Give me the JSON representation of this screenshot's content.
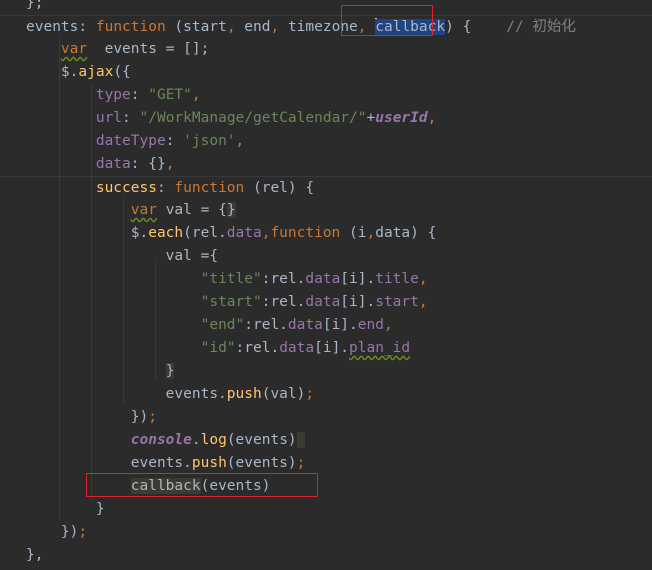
{
  "lines": [
    {
      "tokens": [
        {
          "t": "};",
          "c": "plain"
        }
      ]
    },
    {
      "tokens": [
        {
          "t": "events",
          "c": "plain"
        },
        {
          "t": ": ",
          "c": "plain"
        },
        {
          "t": "function",
          "c": "kw"
        },
        {
          "t": " (start",
          "c": "plain"
        },
        {
          "t": ", ",
          "c": "kw"
        },
        {
          "t": "end",
          "c": "plain"
        },
        {
          "t": ", ",
          "c": "kw"
        },
        {
          "t": "timezone",
          "c": "plain"
        },
        {
          "t": ", ",
          "c": "kw"
        },
        {
          "t": "callback",
          "c": "plain sel",
          "caret": true
        },
        {
          "t": ") {",
          "c": "plain"
        },
        {
          "t": "    // 初始化",
          "c": "cm"
        }
      ]
    },
    {
      "tokens": [
        {
          "t": "    ",
          "c": "plain"
        },
        {
          "t": "var",
          "c": "kw ul"
        },
        {
          "t": "  events = [];",
          "c": "plain"
        }
      ]
    },
    {
      "tokens": [
        {
          "t": "    $.",
          "c": "plain"
        },
        {
          "t": "ajax",
          "c": "fn"
        },
        {
          "t": "({",
          "c": "plain"
        }
      ]
    },
    {
      "tokens": [
        {
          "t": "        ",
          "c": "plain"
        },
        {
          "t": "type",
          "c": "prop"
        },
        {
          "t": ": ",
          "c": "plain"
        },
        {
          "t": "\"GET\"",
          "c": "str"
        },
        {
          "t": ",",
          "c": "kw"
        }
      ]
    },
    {
      "tokens": [
        {
          "t": "        ",
          "c": "plain"
        },
        {
          "t": "url",
          "c": "prop"
        },
        {
          "t": ": ",
          "c": "plain"
        },
        {
          "t": "\"/WorkManage/getCalendar/\"",
          "c": "str"
        },
        {
          "t": "+",
          "c": "plain"
        },
        {
          "t": "userId",
          "c": "gl"
        },
        {
          "t": ",",
          "c": "kw"
        }
      ]
    },
    {
      "tokens": [
        {
          "t": "        ",
          "c": "plain"
        },
        {
          "t": "dateType",
          "c": "prop"
        },
        {
          "t": ": ",
          "c": "plain"
        },
        {
          "t": "'json'",
          "c": "str"
        },
        {
          "t": ",",
          "c": "kw"
        }
      ]
    },
    {
      "tokens": [
        {
          "t": "        ",
          "c": "plain"
        },
        {
          "t": "data",
          "c": "prop"
        },
        {
          "t": ": {}",
          "c": "plain"
        },
        {
          "t": ",",
          "c": "kw"
        }
      ]
    },
    {
      "tokens": [
        {
          "t": "        ",
          "c": "plain"
        },
        {
          "t": "success",
          "c": "fn"
        },
        {
          "t": ": ",
          "c": "plain"
        },
        {
          "t": "function",
          "c": "kw"
        },
        {
          "t": " (rel) {",
          "c": "plain"
        }
      ]
    },
    {
      "tokens": [
        {
          "t": "            ",
          "c": "plain"
        },
        {
          "t": "var",
          "c": "kw ul"
        },
        {
          "t": " val = {",
          "c": "plain"
        },
        {
          "t": "}",
          "c": "plain hl"
        }
      ]
    },
    {
      "tokens": [
        {
          "t": "            $.",
          "c": "plain"
        },
        {
          "t": "each",
          "c": "fn"
        },
        {
          "t": "(rel.",
          "c": "plain"
        },
        {
          "t": "data",
          "c": "prop"
        },
        {
          "t": ",",
          "c": "kw"
        },
        {
          "t": "function",
          "c": "kw"
        },
        {
          "t": " (i",
          "c": "plain"
        },
        {
          "t": ",",
          "c": "kw"
        },
        {
          "t": "data",
          "c": "plain"
        },
        {
          "t": ") {",
          "c": "plain"
        }
      ]
    },
    {
      "tokens": [
        {
          "t": "                val ={",
          "c": "plain"
        }
      ]
    },
    {
      "tokens": [
        {
          "t": "                    ",
          "c": "plain"
        },
        {
          "t": "\"title\"",
          "c": "str"
        },
        {
          "t": ":rel.",
          "c": "plain"
        },
        {
          "t": "data",
          "c": "prop"
        },
        {
          "t": "[i].",
          "c": "plain"
        },
        {
          "t": "title",
          "c": "prop"
        },
        {
          "t": ",",
          "c": "kw"
        }
      ]
    },
    {
      "tokens": [
        {
          "t": "                    ",
          "c": "plain"
        },
        {
          "t": "\"start\"",
          "c": "str"
        },
        {
          "t": ":rel.",
          "c": "plain"
        },
        {
          "t": "data",
          "c": "prop"
        },
        {
          "t": "[i].",
          "c": "plain"
        },
        {
          "t": "start",
          "c": "prop"
        },
        {
          "t": ",",
          "c": "kw"
        }
      ]
    },
    {
      "tokens": [
        {
          "t": "                    ",
          "c": "plain"
        },
        {
          "t": "\"end\"",
          "c": "str"
        },
        {
          "t": ":rel.",
          "c": "plain"
        },
        {
          "t": "data",
          "c": "prop"
        },
        {
          "t": "[i].",
          "c": "plain"
        },
        {
          "t": "end",
          "c": "prop"
        },
        {
          "t": ",",
          "c": "kw"
        }
      ]
    },
    {
      "tokens": [
        {
          "t": "                    ",
          "c": "plain"
        },
        {
          "t": "\"id\"",
          "c": "str"
        },
        {
          "t": ":rel.",
          "c": "plain"
        },
        {
          "t": "data",
          "c": "prop"
        },
        {
          "t": "[i].",
          "c": "plain"
        },
        {
          "t": "plan_id",
          "c": "prop ul"
        }
      ]
    },
    {
      "tokens": [
        {
          "t": "                ",
          "c": "plain"
        },
        {
          "t": "}",
          "c": "plain hl"
        }
      ]
    },
    {
      "tokens": [
        {
          "t": "                events.",
          "c": "plain"
        },
        {
          "t": "push",
          "c": "fn"
        },
        {
          "t": "(val)",
          "c": "plain"
        },
        {
          "t": ";",
          "c": "kw"
        }
      ]
    },
    {
      "tokens": [
        {
          "t": "            })",
          "c": "plain"
        },
        {
          "t": ";",
          "c": "kw"
        }
      ]
    },
    {
      "tokens": [
        {
          "t": "            ",
          "c": "plain"
        },
        {
          "t": "console",
          "c": "gl"
        },
        {
          "t": ".",
          "c": "plain"
        },
        {
          "t": "log",
          "c": "fn"
        },
        {
          "t": "(events)",
          "c": "plain"
        },
        {
          "t": " ",
          "c": "plain hl"
        }
      ]
    },
    {
      "tokens": [
        {
          "t": "            events.",
          "c": "plain"
        },
        {
          "t": "push",
          "c": "fn"
        },
        {
          "t": "(events)",
          "c": "plain"
        },
        {
          "t": ";",
          "c": "kw"
        }
      ]
    },
    {
      "tokens": [
        {
          "t": "            ",
          "c": "plain"
        },
        {
          "t": "callback",
          "c": "plain hl"
        },
        {
          "t": "(events)",
          "c": "plain"
        }
      ]
    },
    {
      "tokens": [
        {
          "t": "        }",
          "c": "plain"
        }
      ]
    },
    {
      "tokens": [
        {
          "t": "    })",
          "c": "plain"
        },
        {
          "t": ";",
          "c": "kw"
        }
      ]
    },
    {
      "tokens": [
        {
          "t": "},",
          "c": "plain"
        }
      ]
    }
  ],
  "colors": {
    "background": "#2b2b2b",
    "keyword": "#cc7832",
    "function": "#ffc66d",
    "string": "#6a8759",
    "property": "#9876aa",
    "text": "#a9b7c6",
    "comment": "#808080",
    "highlight_box": "#e0202a"
  }
}
